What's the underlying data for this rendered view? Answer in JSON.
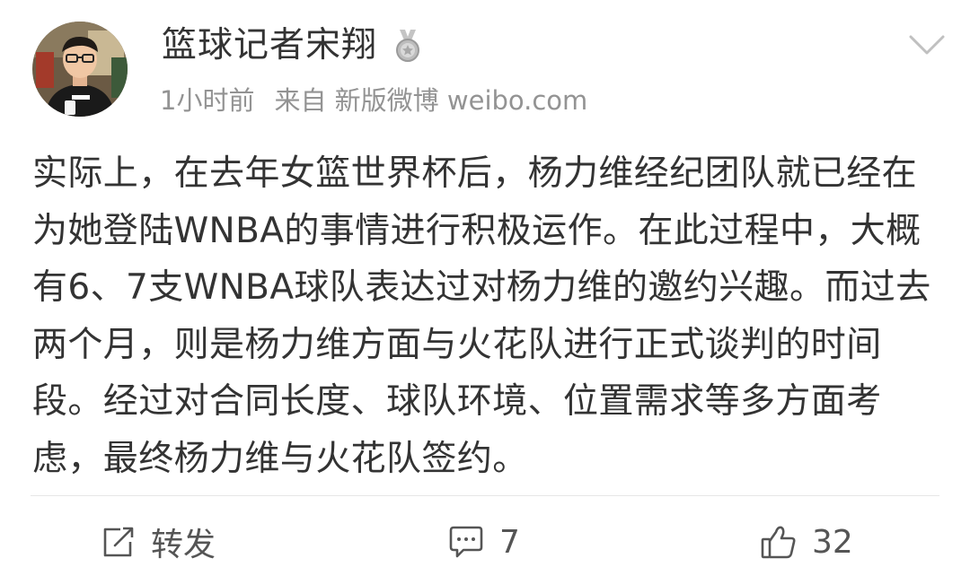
{
  "post": {
    "author": {
      "name": "篮球记者宋翔",
      "badge_icon": "medal-badge-icon",
      "avatar_icon": "user-avatar"
    },
    "meta": {
      "time": "1小时前",
      "source": "来自 新版微博 weibo.com"
    },
    "more_icon": "chevron-down-icon",
    "text": "实际上，在去年女篮世界杯后，杨力维经纪团队就已经在为她登陆WNBA的事情进行积极运作。在此过程中，大概有6、7支WNBA球队表达过对杨力维的邀约兴趣。而过去两个月，则是杨力维方面与火花队进行正式谈判的时间段。经过对合同长度、球队环境、位置需求等多方面考虑，最终杨力维与火花队签约。"
  },
  "actions": {
    "repost": {
      "label": "转发",
      "icon": "repost-icon"
    },
    "comment": {
      "count": "7",
      "icon": "comment-icon"
    },
    "like": {
      "count": "32",
      "icon": "thumbs-up-icon"
    }
  },
  "colors": {
    "text": "#333333",
    "meta": "#939393",
    "divider": "#e6e6e6",
    "icon": "#555555"
  }
}
